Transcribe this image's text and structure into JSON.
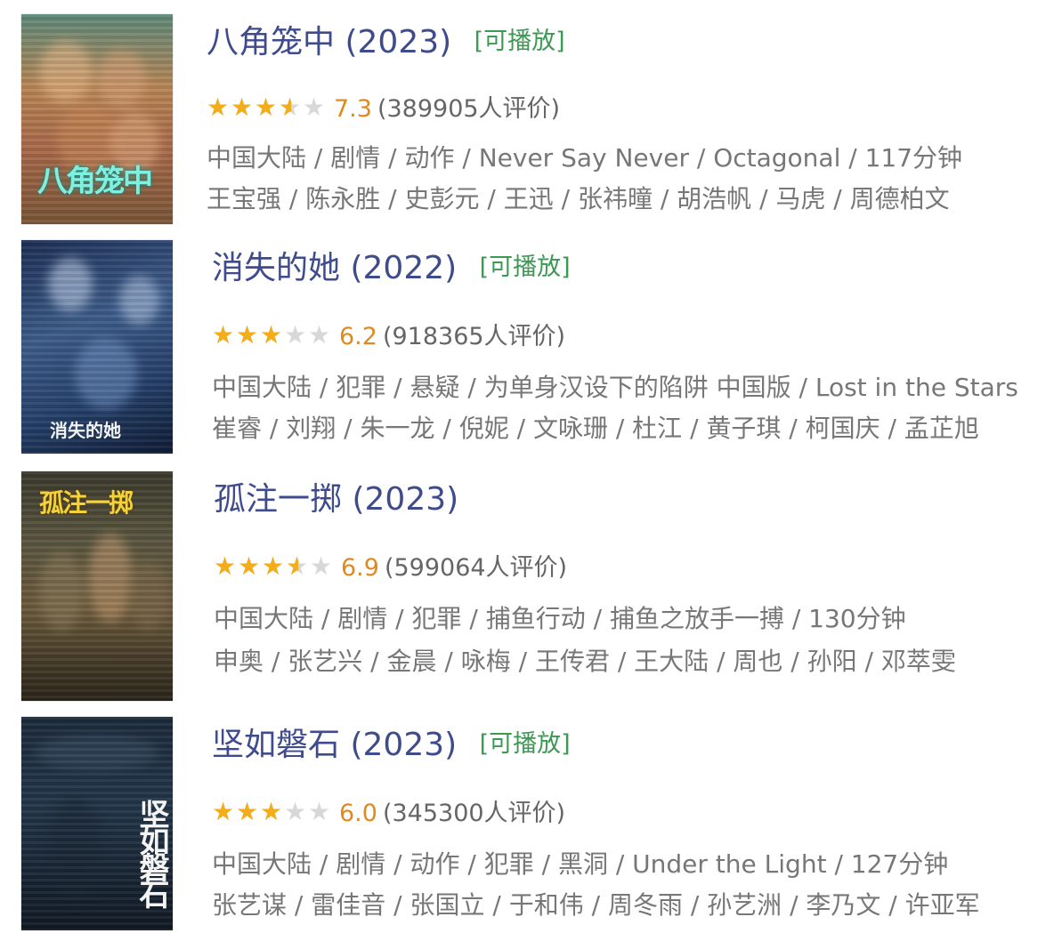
{
  "colors": {
    "title": "#3e4b8c",
    "tag": "#3a9a52",
    "star_on": "#f4ad1a",
    "star_off": "#d8d8d8",
    "score": "#e08a1e",
    "meta": "#777777"
  },
  "items": [
    {
      "title": "八角笼中",
      "year": "(2023)",
      "tag": "[可播放]",
      "score": "7.3",
      "rating": 7.3,
      "votes": "(389905人评价)",
      "info": "中国大陆 / 剧情 / 动作 / Never Say Never / Octagonal / 117分钟",
      "cast": "王宝强 / 陈永胜 / 史彭元 / 王迅 / 张祎曈 / 胡浩帆 / 马虎 / 周德柏文",
      "poster_text": "八角笼中"
    },
    {
      "title": "消失的她",
      "year": "(2022)",
      "tag": "[可播放]",
      "score": "6.2",
      "rating": 6.2,
      "votes": "(918365人评价)",
      "info": "中国大陆 / 犯罪 / 悬疑 / 为单身汉设下的陷阱 中国版 / Lost in the Stars",
      "cast": "崔睿 / 刘翔 / 朱一龙 / 倪妮 / 文咏珊 / 杜江 / 黄子琪 / 柯国庆 / 孟芷旭",
      "poster_text": "消失的她"
    },
    {
      "title": "孤注一掷",
      "year": "(2023)",
      "tag": "",
      "score": "6.9",
      "rating": 6.9,
      "votes": "(599064人评价)",
      "info": "中国大陆 / 剧情 / 犯罪 / 捕鱼行动 / 捕鱼之放手一搏 / 130分钟",
      "cast": "申奥 / 张艺兴 / 金晨 / 咏梅 / 王传君 / 王大陆 / 周也 / 孙阳 / 邓萃雯",
      "poster_text": "孤注一掷"
    },
    {
      "title": "坚如磐石",
      "year": "(2023)",
      "tag": "[可播放]",
      "score": "6.0",
      "rating": 6.0,
      "votes": "(345300人评价)",
      "info": "中国大陆 / 剧情 / 动作 / 犯罪 / 黑洞 / Under the Light / 127分钟",
      "cast": "张艺谋 / 雷佳音 / 张国立 / 于和伟 / 周冬雨 / 孙艺洲 / 李乃文 / 许亚军",
      "poster_text": "坚如磐石"
    }
  ]
}
